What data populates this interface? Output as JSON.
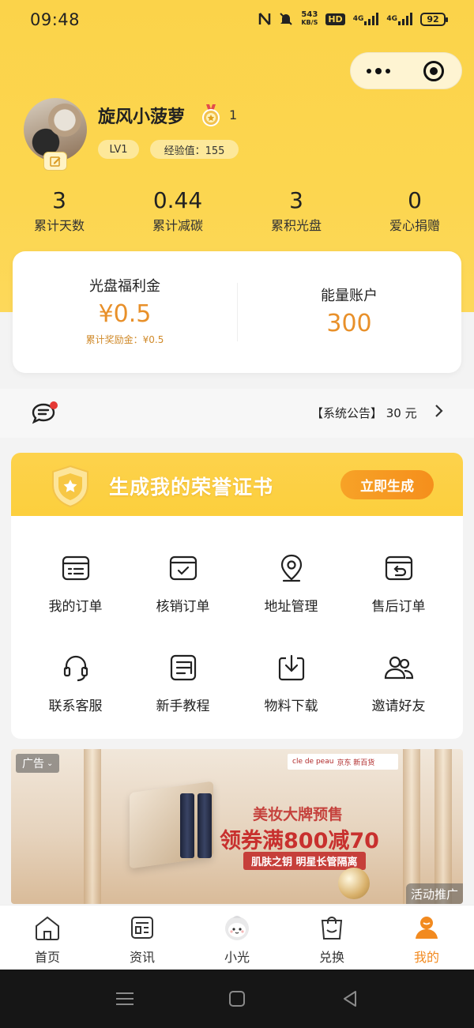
{
  "status_bar": {
    "time": "09:48",
    "net_speed_value": "543",
    "net_speed_unit": "KB/S",
    "hd_label": "HD",
    "sig1_label": "4G",
    "sig2_label": "4G",
    "battery": "92"
  },
  "profile": {
    "username": "旋风小菠萝",
    "medal_count": "1",
    "level": "LV1",
    "exp": "经验值：155"
  },
  "stats": [
    {
      "value": "3",
      "label": "累计天数"
    },
    {
      "value": "0.44",
      "label": "累计减碳"
    },
    {
      "value": "3",
      "label": "累积光盘"
    },
    {
      "value": "0",
      "label": "爱心捐赠"
    }
  ],
  "wallet": {
    "welfare_title": "光盘福利金",
    "welfare_amount": "¥0.5",
    "welfare_sub": "累计奖励金：¥0.5",
    "energy_title": "能量账户",
    "energy_amount": "300"
  },
  "notice": {
    "text": "【系统公告】 30 元"
  },
  "honor": {
    "title": "生成我的荣誉证书",
    "button": "立即生成"
  },
  "services": [
    {
      "label": "我的订单",
      "icon": "order-list-icon"
    },
    {
      "label": "核销订单",
      "icon": "verify-order-icon"
    },
    {
      "label": "地址管理",
      "icon": "location-pin-icon"
    },
    {
      "label": "售后订单",
      "icon": "after-sale-icon"
    },
    {
      "label": "联系客服",
      "icon": "headset-icon"
    },
    {
      "label": "新手教程",
      "icon": "tutorial-icon"
    },
    {
      "label": "物料下载",
      "icon": "download-icon"
    },
    {
      "label": "邀请好友",
      "icon": "invite-friends-icon"
    }
  ],
  "ad": {
    "tag": "广告",
    "brand1": "cle de peau",
    "brand2": "京东 新百货",
    "line1": "美妆大牌预售",
    "line2": "领券满800减70",
    "line3": "肌肤之钥 明星长管隔离",
    "corner": "活动推广"
  },
  "tabs": [
    {
      "label": "首页",
      "icon": "home-icon",
      "active": false
    },
    {
      "label": "资讯",
      "icon": "news-icon",
      "active": false
    },
    {
      "label": "小光",
      "icon": "mascot-icon",
      "active": false
    },
    {
      "label": "兑换",
      "icon": "shopping-bag-icon",
      "active": false
    },
    {
      "label": "我的",
      "icon": "profile-icon",
      "active": true
    }
  ],
  "colors": {
    "brand_yellow": "#fbd34a",
    "accent_orange": "#e8902a",
    "active_tab": "#f28a1f"
  }
}
